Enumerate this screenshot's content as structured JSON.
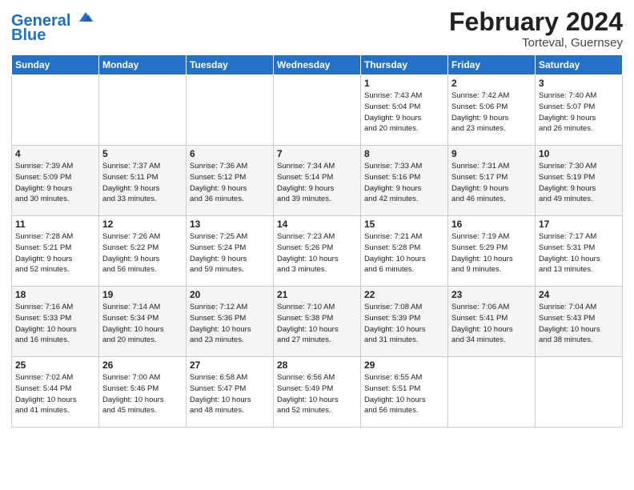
{
  "header": {
    "logo_line1": "General",
    "logo_line2": "Blue",
    "month_title": "February 2024",
    "location": "Torteval, Guernsey"
  },
  "weekdays": [
    "Sunday",
    "Monday",
    "Tuesday",
    "Wednesday",
    "Thursday",
    "Friday",
    "Saturday"
  ],
  "weeks": [
    [
      {
        "day": "",
        "info": ""
      },
      {
        "day": "",
        "info": ""
      },
      {
        "day": "",
        "info": ""
      },
      {
        "day": "",
        "info": ""
      },
      {
        "day": "1",
        "info": "Sunrise: 7:43 AM\nSunset: 5:04 PM\nDaylight: 9 hours\nand 20 minutes."
      },
      {
        "day": "2",
        "info": "Sunrise: 7:42 AM\nSunset: 5:06 PM\nDaylight: 9 hours\nand 23 minutes."
      },
      {
        "day": "3",
        "info": "Sunrise: 7:40 AM\nSunset: 5:07 PM\nDaylight: 9 hours\nand 26 minutes."
      }
    ],
    [
      {
        "day": "4",
        "info": "Sunrise: 7:39 AM\nSunset: 5:09 PM\nDaylight: 9 hours\nand 30 minutes."
      },
      {
        "day": "5",
        "info": "Sunrise: 7:37 AM\nSunset: 5:11 PM\nDaylight: 9 hours\nand 33 minutes."
      },
      {
        "day": "6",
        "info": "Sunrise: 7:36 AM\nSunset: 5:12 PM\nDaylight: 9 hours\nand 36 minutes."
      },
      {
        "day": "7",
        "info": "Sunrise: 7:34 AM\nSunset: 5:14 PM\nDaylight: 9 hours\nand 39 minutes."
      },
      {
        "day": "8",
        "info": "Sunrise: 7:33 AM\nSunset: 5:16 PM\nDaylight: 9 hours\nand 42 minutes."
      },
      {
        "day": "9",
        "info": "Sunrise: 7:31 AM\nSunset: 5:17 PM\nDaylight: 9 hours\nand 46 minutes."
      },
      {
        "day": "10",
        "info": "Sunrise: 7:30 AM\nSunset: 5:19 PM\nDaylight: 9 hours\nand 49 minutes."
      }
    ],
    [
      {
        "day": "11",
        "info": "Sunrise: 7:28 AM\nSunset: 5:21 PM\nDaylight: 9 hours\nand 52 minutes."
      },
      {
        "day": "12",
        "info": "Sunrise: 7:26 AM\nSunset: 5:22 PM\nDaylight: 9 hours\nand 56 minutes."
      },
      {
        "day": "13",
        "info": "Sunrise: 7:25 AM\nSunset: 5:24 PM\nDaylight: 9 hours\nand 59 minutes."
      },
      {
        "day": "14",
        "info": "Sunrise: 7:23 AM\nSunset: 5:26 PM\nDaylight: 10 hours\nand 3 minutes."
      },
      {
        "day": "15",
        "info": "Sunrise: 7:21 AM\nSunset: 5:28 PM\nDaylight: 10 hours\nand 6 minutes."
      },
      {
        "day": "16",
        "info": "Sunrise: 7:19 AM\nSunset: 5:29 PM\nDaylight: 10 hours\nand 9 minutes."
      },
      {
        "day": "17",
        "info": "Sunrise: 7:17 AM\nSunset: 5:31 PM\nDaylight: 10 hours\nand 13 minutes."
      }
    ],
    [
      {
        "day": "18",
        "info": "Sunrise: 7:16 AM\nSunset: 5:33 PM\nDaylight: 10 hours\nand 16 minutes."
      },
      {
        "day": "19",
        "info": "Sunrise: 7:14 AM\nSunset: 5:34 PM\nDaylight: 10 hours\nand 20 minutes."
      },
      {
        "day": "20",
        "info": "Sunrise: 7:12 AM\nSunset: 5:36 PM\nDaylight: 10 hours\nand 23 minutes."
      },
      {
        "day": "21",
        "info": "Sunrise: 7:10 AM\nSunset: 5:38 PM\nDaylight: 10 hours\nand 27 minutes."
      },
      {
        "day": "22",
        "info": "Sunrise: 7:08 AM\nSunset: 5:39 PM\nDaylight: 10 hours\nand 31 minutes."
      },
      {
        "day": "23",
        "info": "Sunrise: 7:06 AM\nSunset: 5:41 PM\nDaylight: 10 hours\nand 34 minutes."
      },
      {
        "day": "24",
        "info": "Sunrise: 7:04 AM\nSunset: 5:43 PM\nDaylight: 10 hours\nand 38 minutes."
      }
    ],
    [
      {
        "day": "25",
        "info": "Sunrise: 7:02 AM\nSunset: 5:44 PM\nDaylight: 10 hours\nand 41 minutes."
      },
      {
        "day": "26",
        "info": "Sunrise: 7:00 AM\nSunset: 5:46 PM\nDaylight: 10 hours\nand 45 minutes."
      },
      {
        "day": "27",
        "info": "Sunrise: 6:58 AM\nSunset: 5:47 PM\nDaylight: 10 hours\nand 48 minutes."
      },
      {
        "day": "28",
        "info": "Sunrise: 6:56 AM\nSunset: 5:49 PM\nDaylight: 10 hours\nand 52 minutes."
      },
      {
        "day": "29",
        "info": "Sunrise: 6:55 AM\nSunset: 5:51 PM\nDaylight: 10 hours\nand 56 minutes."
      },
      {
        "day": "",
        "info": ""
      },
      {
        "day": "",
        "info": ""
      }
    ]
  ]
}
